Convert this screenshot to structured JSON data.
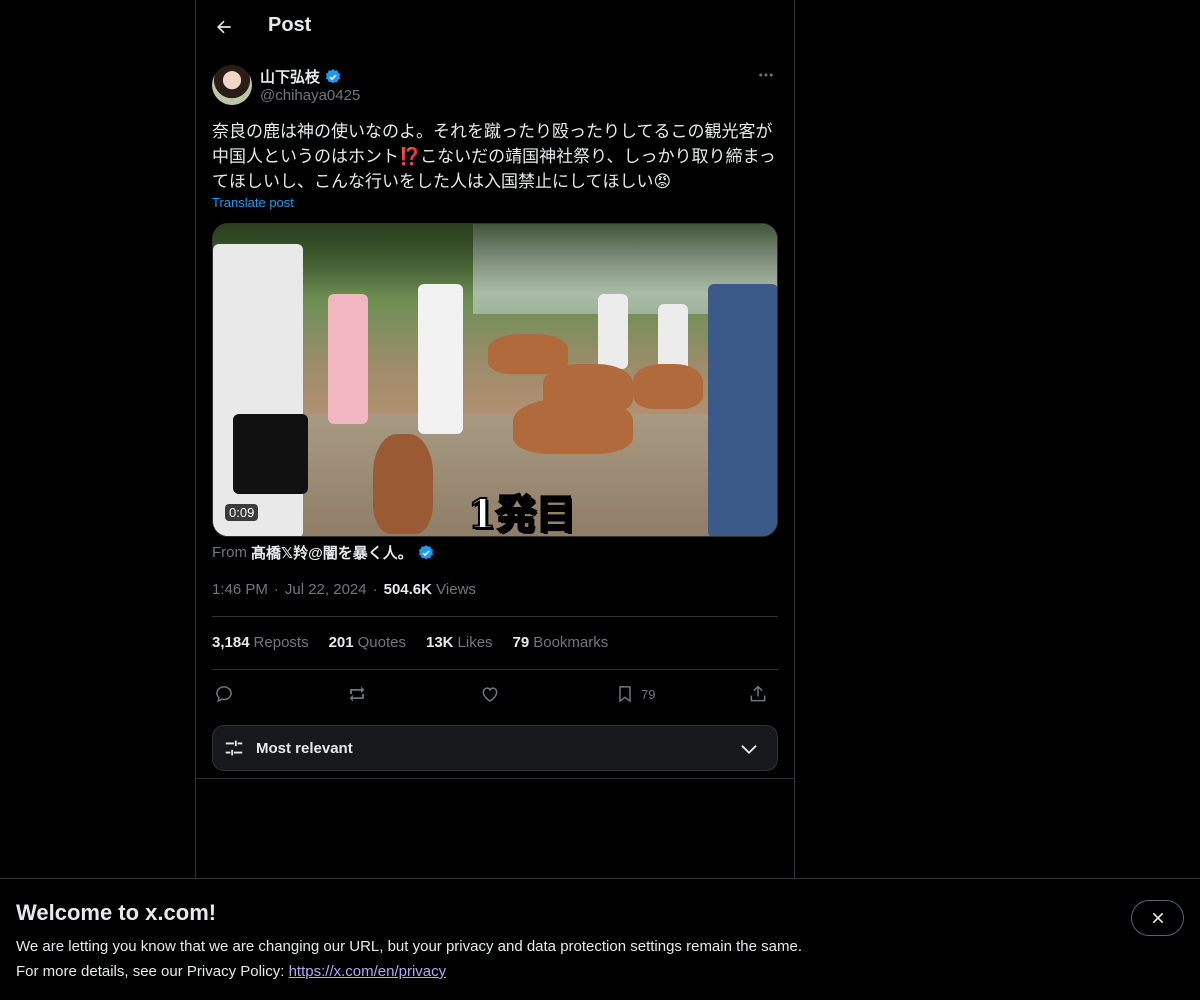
{
  "header": {
    "title": "Post"
  },
  "post": {
    "author_name": "山下弘枝",
    "author_handle": "@chihaya0425",
    "text": "奈良の鹿は神の使いなのよ。それを蹴ったり殴ったりしてるこの観光客が\n中国人というのはホント⁉️こないだの靖国神社祭り、しっかり取り締まっ\nてほしいし、こんな行いをした人は入国禁止にしてほしい😡",
    "translate_label": "Translate post",
    "video": {
      "overlay_caption": "1発目",
      "duration": "0:09"
    },
    "from_prefix": "From",
    "from_name": "髙橋𝕏羚@闇を暴く人。",
    "time": "1:46 PM",
    "separator": "·",
    "date": "Jul 22, 2024",
    "views_count": "504.6K",
    "views_label": "Views"
  },
  "stats": [
    {
      "num": "3,184",
      "label": "Reposts"
    },
    {
      "num": "201",
      "label": "Quotes"
    },
    {
      "num": "13K",
      "label": "Likes"
    },
    {
      "num": "79",
      "label": "Bookmarks"
    }
  ],
  "actions": {
    "bookmark_count": "79"
  },
  "sort": {
    "label": "Most relevant"
  },
  "banner": {
    "title": "Welcome to x.com!",
    "line1": "We are letting you know that we are changing our URL, but your privacy and data protection settings remain the same.",
    "line2_prefix": "For more details, see our Privacy Policy: ",
    "link": "https://x.com/en/privacy"
  },
  "colors": {
    "accent": "#1d9bf0",
    "verified": "#1d9bf0",
    "muted": "#71767b",
    "border": "#2f3336"
  }
}
